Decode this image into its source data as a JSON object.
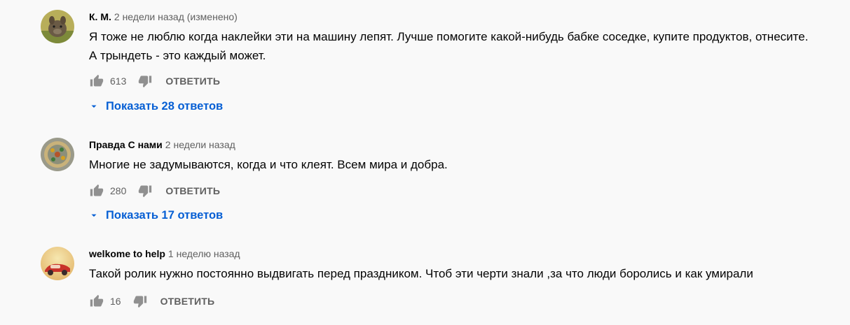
{
  "comments": [
    {
      "author": "К. М.",
      "time": "2 недели назад (изменено)",
      "text": "Я тоже не люблю когда наклейки эти на машину лепят. Лучше помогите какой-нибудь бабке соседке, купите продуктов, отнесите. А трындеть - это каждый может.",
      "likes": "613",
      "reply_label": "ОТВЕТИТЬ",
      "replies_label": "Показать 28 ответов"
    },
    {
      "author": "Правда С нами",
      "time": "2 недели назад",
      "text": "Многие не задумываются, когда и что клеят. Всем мира и добра.",
      "likes": "280",
      "reply_label": "ОТВЕТИТЬ",
      "replies_label": "Показать 17 ответов"
    },
    {
      "author": "welkome to help",
      "time": "1 неделю назад",
      "text": "Такой ролик нужно постоянно выдвигать перед праздником. Чтоб эти черти знали ,за что люди боролись и как умирали",
      "likes": "16",
      "reply_label": "ОТВЕТИТЬ"
    }
  ],
  "icons": {
    "like": "thumb-up-icon",
    "dislike": "thumb-down-icon",
    "expand": "caret-down-icon"
  },
  "colors": {
    "background": "#f9f9f9",
    "text": "#030303",
    "secondary": "#606060",
    "link": "#065fd4"
  }
}
